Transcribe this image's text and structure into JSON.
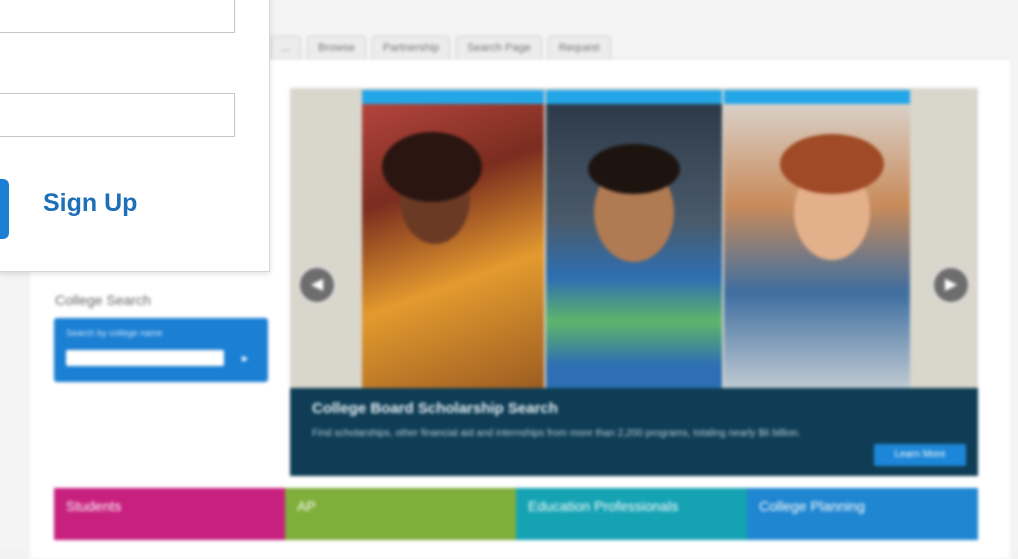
{
  "nav_tabs": [
    "...",
    "Browse",
    "Partnership",
    "Search Page",
    "Request"
  ],
  "college_search": {
    "title": "College Search",
    "hint": "Search by college name"
  },
  "carousel": {
    "caption_title": "College Board Scholarship Search",
    "caption_text": "Find scholarships, other financial aid and internships from more than 2,200 programs, totaling nearly $6 billion.",
    "caption_button": "Learn More",
    "prev_icon": "chevron-left-icon",
    "next_icon": "chevron-right-icon"
  },
  "tiles": [
    {
      "label": "Students",
      "color": "#c8207e"
    },
    {
      "label": "AP",
      "color": "#7fae3a"
    },
    {
      "label": "Education Professionals",
      "color": "#15a3b4"
    },
    {
      "label": "College Planning",
      "color": "#1f86d1"
    }
  ],
  "signin": {
    "username_placeholder": "",
    "password_placeholder": "",
    "signup_label": "Sign Up",
    "accent_color": "#1b7fd3"
  }
}
